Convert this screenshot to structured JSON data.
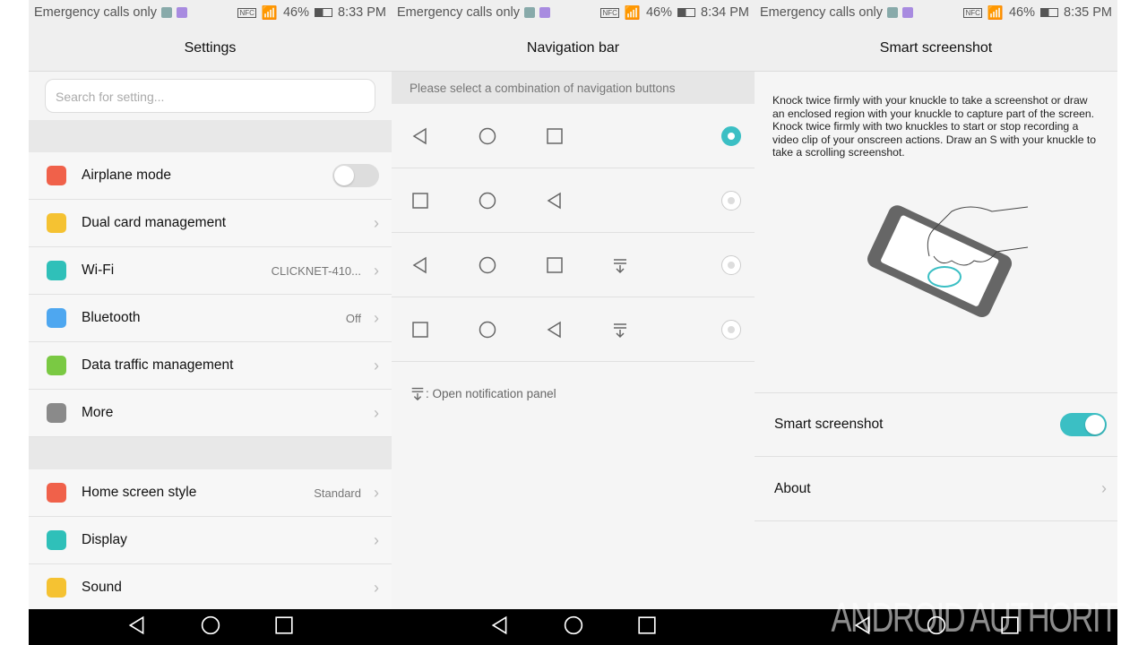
{
  "status_bars": [
    {
      "carrier": "Emergency calls only",
      "nfc": "NFC",
      "battery": "46%",
      "time": "8:33 PM"
    },
    {
      "carrier": "Emergency calls only",
      "nfc": "NFC",
      "battery": "46%",
      "time": "8:34 PM"
    },
    {
      "carrier": "Emergency calls only",
      "nfc": "NFC",
      "battery": "46%",
      "time": "8:35 PM"
    }
  ],
  "settings": {
    "title": "Settings",
    "search_placeholder": "Search for setting...",
    "group1": [
      {
        "label": "Airplane mode",
        "icon": "airplane-icon",
        "color": "#f0614a",
        "toggle": false
      },
      {
        "label": "Dual card management",
        "icon": "sim-icon",
        "color": "#f5c232",
        "value": ""
      },
      {
        "label": "Wi-Fi",
        "icon": "wifi-icon",
        "color": "#2fc0b9",
        "value": "CLICKNET-410..."
      },
      {
        "label": "Bluetooth",
        "icon": "bluetooth-icon",
        "color": "#4ea7f0",
        "value": "Off"
      },
      {
        "label": "Data traffic management",
        "icon": "data-icon",
        "color": "#7ac943",
        "value": ""
      },
      {
        "label": "More",
        "icon": "more-icon",
        "color": "#8a8a8a",
        "value": ""
      }
    ],
    "group2": [
      {
        "label": "Home screen style",
        "icon": "home-icon",
        "color": "#f0614a",
        "value": "Standard"
      },
      {
        "label": "Display",
        "icon": "display-icon",
        "color": "#2fc0b9",
        "value": ""
      },
      {
        "label": "Sound",
        "icon": "sound-icon",
        "color": "#f5c232",
        "value": ""
      }
    ]
  },
  "navigation": {
    "title": "Navigation bar",
    "hint": "Please select a combination of navigation buttons",
    "legend": ": Open notification panel",
    "selected_index": 0
  },
  "smart": {
    "title": "Smart screenshot",
    "description": "Knock twice firmly with your knuckle to take a screenshot or draw an enclosed region with your knuckle to capture part of the screen. Knock twice firmly with two knuckles to start or stop recording a video clip of your onscreen actions. Draw an S with your knuckle to take a scrolling screenshot.",
    "toggle_label": "Smart screenshot",
    "toggle_on": true,
    "about_label": "About"
  },
  "accent": "#3bbfc4",
  "watermark": "ANDROID AUTHORITY"
}
